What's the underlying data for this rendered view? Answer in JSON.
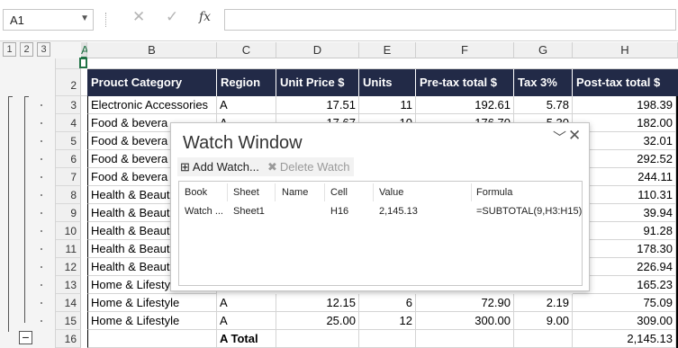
{
  "formula_bar": {
    "name_box": "A1",
    "cancel_glyph": "✕",
    "enter_glyph": "✓",
    "fx_label": "fx",
    "formula": ""
  },
  "outline_levels": [
    "1",
    "2",
    "3"
  ],
  "columns": [
    "A",
    "B",
    "C",
    "D",
    "E",
    "F",
    "G",
    "H"
  ],
  "rows": [
    "1",
    "2",
    "3",
    "4",
    "5",
    "6",
    "7",
    "8",
    "9",
    "10",
    "11",
    "12",
    "13",
    "14",
    "15",
    "16"
  ],
  "header_row": {
    "category": "Prouct Category",
    "region": "Region",
    "unit_price": "Unit Price $",
    "units": "Units",
    "pretax": "Pre-tax total $",
    "tax": "Tax 3%",
    "posttax": "Post-tax total $"
  },
  "visible_cells": {
    "r3": {
      "b": "Electronic Accessories",
      "c": "A",
      "d": "17.51",
      "e": "11",
      "f": "192.61",
      "g": "5.78",
      "h": "198.39"
    },
    "r4": {
      "b": "Food & bevera",
      "c": "A",
      "d": "17.67",
      "e": "10",
      "f": "176.70",
      "g": "5.30",
      "h": "182.00"
    },
    "r5": {
      "b": "Food & bevera",
      "h": "32.01"
    },
    "r6": {
      "b": "Food & bevera",
      "h": "292.52"
    },
    "r7": {
      "b": "Food & bevera",
      "h": "244.11"
    },
    "r8": {
      "b": "Health & Beaut",
      "h": "110.31"
    },
    "r9": {
      "b": "Health & Beaut",
      "h": "39.94"
    },
    "r10": {
      "b": "Health & Beaut",
      "h": "91.28"
    },
    "r11": {
      "b": "Health & Beaut",
      "h": "178.30"
    },
    "r12": {
      "b": "Health & Beaut",
      "h": "226.94"
    },
    "r13": {
      "b": "Home & Lifesty",
      "h": "165.23"
    },
    "r14": {
      "b": "Home & Lifestyle",
      "c": "A",
      "d": "12.15",
      "e": "6",
      "f": "72.90",
      "g": "2.19",
      "h": "75.09"
    },
    "r15": {
      "b": "Home & Lifestyle",
      "c": "A",
      "d": "25.00",
      "e": "12",
      "f": "300.00",
      "g": "9.00",
      "h": "309.00"
    },
    "r16": {
      "c": "A Total",
      "h": "2,145.13"
    }
  },
  "watch_window": {
    "title": "Watch Window",
    "add_watch": "Add Watch...",
    "delete_watch": "Delete Watch",
    "headers": {
      "book": "Book",
      "sheet": "Sheet",
      "name": "Name",
      "cell": "Cell",
      "value": "Value",
      "formula": "Formula"
    },
    "entry": {
      "book": "Watch ...",
      "sheet": "Sheet1",
      "name": "",
      "cell": "H16",
      "value": "2,145.13",
      "formula": "=SUBTOTAL(9,H3:H15)"
    }
  },
  "colors": {
    "header_fill": "#222a47",
    "header_text": "#ffffff",
    "excel_green": "#217346"
  },
  "icons": {
    "collapse": "−"
  }
}
